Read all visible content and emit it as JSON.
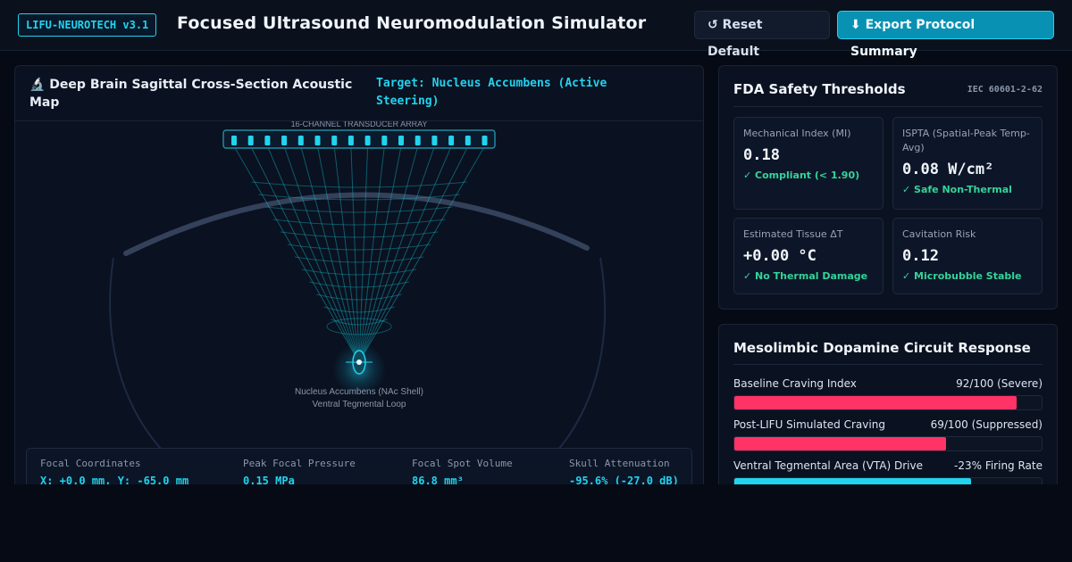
{
  "header": {
    "badge": "LIFU-NEUROTECH v3.1",
    "title": "Focused Ultrasound Neuromodulation Simulator",
    "reset_label": "↺ Reset Default",
    "export_label": "⬇ Export Protocol Summary"
  },
  "map": {
    "icon": "microscope-icon",
    "title": "🔬 Deep Brain Sagittal Cross-Section Acoustic Map",
    "target": "Target: Nucleus Accumbens (Active Steering)",
    "array_label": "16-CHANNEL TRANSDUCER ARRAY",
    "element_count": 16,
    "focus_label_1": "Nucleus Accumbens (NAc Shell)",
    "focus_label_2": "Ventral Tegmental Loop",
    "stats": [
      {
        "label": "Focal Coordinates",
        "value": "X: +0.0 mm, Y: -65.0 mm"
      },
      {
        "label": "Peak Focal Pressure",
        "value": "0.15 MPa"
      },
      {
        "label": "Focal Spot Volume",
        "value": "86.8 mm³"
      },
      {
        "label": "Skull Attenuation",
        "value": "-95.6% (-27.0 dB)"
      }
    ]
  },
  "safety": {
    "title": "FDA Safety Thresholds",
    "standard": "IEC 60601-2-62",
    "cards": [
      {
        "label": "Mechanical Index (MI)",
        "value": "0.18",
        "status": "✓ Compliant (< 1.90)"
      },
      {
        "label": "ISPTA (Spatial-Peak Temp-Avg)",
        "value": "0.08 W/cm²",
        "status": "✓ Safe Non-Thermal"
      },
      {
        "label": "Estimated Tissue ΔT",
        "value": "+0.00 °C",
        "status": "✓ No Thermal Damage"
      },
      {
        "label": "Cavitation Risk",
        "value": "0.12",
        "status": "✓ Microbubble Stable"
      }
    ]
  },
  "circuit": {
    "title": "Mesolimbic Dopamine Circuit Response",
    "bars": [
      {
        "label": "Baseline Craving Index",
        "value": "92/100 (Severe)",
        "fraction": 0.92,
        "color": "#ff3366"
      },
      {
        "label": "Post-LIFU Simulated Craving",
        "value": "69/100 (Suppressed)",
        "fraction": 0.69,
        "color": "#ff3366"
      },
      {
        "label": "Ventral Tegmental Area (VTA) Drive",
        "value": "-23% Firing Rate",
        "fraction": 0.77,
        "color": "#22d3ee"
      }
    ]
  },
  "colors": {
    "accent": "#22d3ee",
    "danger": "#ff3366",
    "ok": "#34d399",
    "background": "#060a14"
  }
}
